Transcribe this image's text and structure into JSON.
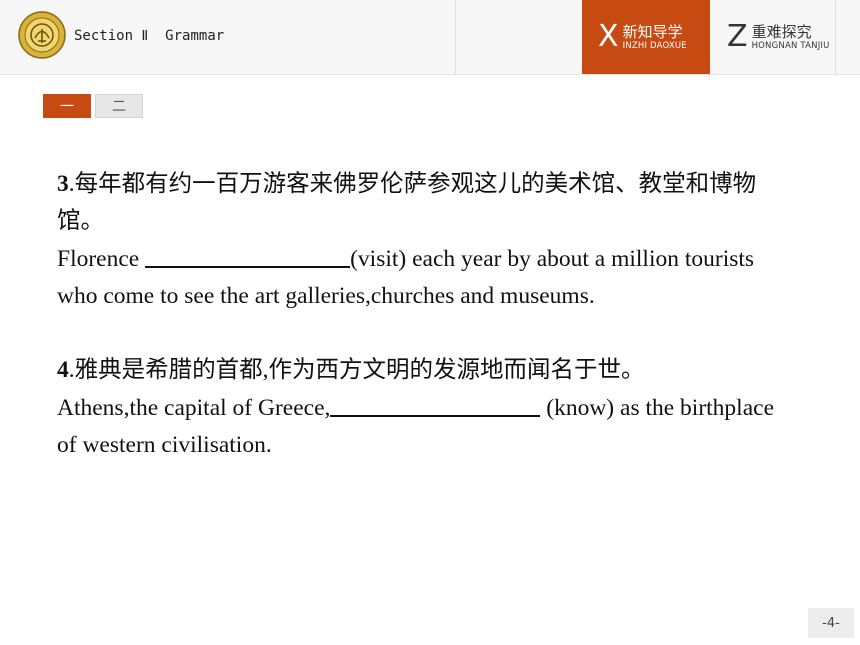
{
  "header": {
    "section_title": "Section Ⅱ  Grammar",
    "tabs": [
      {
        "letter": "X",
        "label": "新知导学",
        "pinyin": "INZHI DAOXUE",
        "active": true
      },
      {
        "letter": "Z",
        "label": "重难探究",
        "pinyin": "HONGNAN TANJIU",
        "active": false
      }
    ]
  },
  "page_tabs": [
    {
      "label": "一",
      "active": true
    },
    {
      "label": "二",
      "active": false
    }
  ],
  "questions": [
    {
      "number": "3",
      "chinese": ".每年都有约一百万游客来佛罗伦萨参观这儿的美术馆、教堂和博物馆。",
      "en_before": "Florence ",
      "en_after": "(visit) each year by about a million tourists who come to see the art galleries,churches and museums."
    },
    {
      "number": "4",
      "chinese": ".雅典是希腊的首都,作为西方文明的发源地而闻名于世。",
      "en_before": "Athens,the capital of Greece,",
      "en_after": " (know) as the birthplace of western civilisation."
    }
  ],
  "page_number": "-4-",
  "colors": {
    "accent": "#c74a12",
    "header_bg": "#f7f7f7"
  }
}
